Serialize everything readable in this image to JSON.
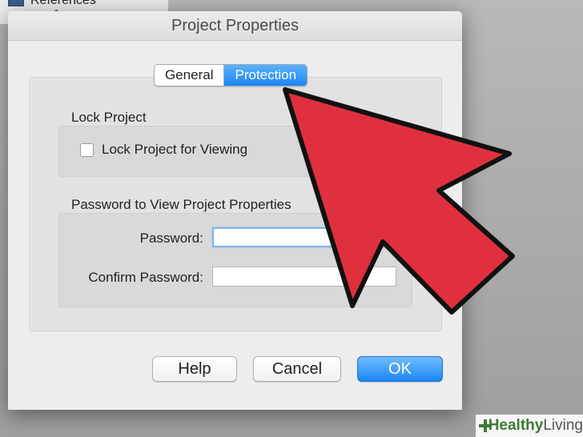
{
  "background": {
    "sidebar_item_label": "References"
  },
  "dialog": {
    "title": "Project Properties",
    "tabs": [
      {
        "label": "General",
        "active": false
      },
      {
        "label": "Protection",
        "active": true
      }
    ],
    "lock_group": {
      "title": "Lock Project",
      "checkbox_label": "Lock Project for Viewing",
      "checked": false
    },
    "password_group": {
      "title": "Password to View Project Properties",
      "password_label": "Password:",
      "password_value": "",
      "confirm_label": "Confirm Password:",
      "confirm_value": ""
    },
    "buttons": {
      "help": "Help",
      "cancel": "Cancel",
      "ok": "OK"
    }
  },
  "overlay": {
    "arrow_color": "#e0303e"
  },
  "watermark": {
    "part1": "Healthy",
    "part2": "Living"
  }
}
